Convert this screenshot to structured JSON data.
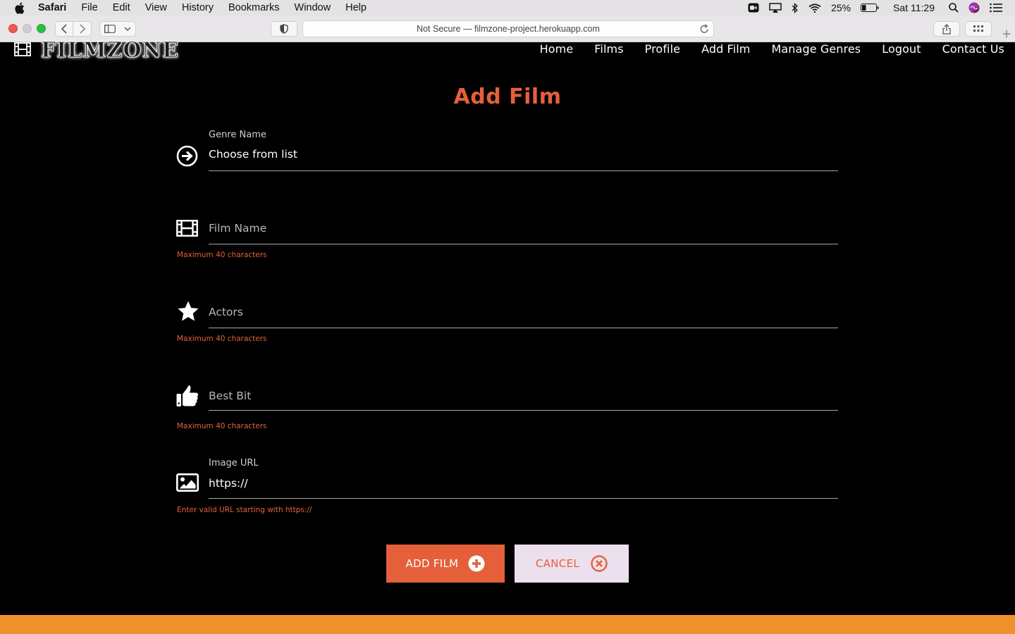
{
  "menubar": {
    "app": "Safari",
    "items": [
      "File",
      "Edit",
      "View",
      "History",
      "Bookmarks",
      "Window",
      "Help"
    ],
    "battery": "25%",
    "clock": "Sat 11:29"
  },
  "browser": {
    "url": "Not Secure — filmzone-project.herokuapp.com"
  },
  "site": {
    "brand": "FILMZONE",
    "nav": {
      "home": "Home",
      "films": "Films",
      "profile": "Profile",
      "add_film": "Add Film",
      "manage_genres": "Manage Genres",
      "logout": "Logout",
      "contact": "Contact Us"
    }
  },
  "form": {
    "title": "Add Film",
    "genre": {
      "label": "Genre Name",
      "value": "Choose from list"
    },
    "film_name": {
      "placeholder": "Film Name",
      "helper": "Maximum 40 characters"
    },
    "actors": {
      "placeholder": "Actors",
      "helper": "Maximum 40 characters"
    },
    "best_bit": {
      "placeholder": "Best Bit",
      "helper": "Maximum 40 characters"
    },
    "image_url": {
      "label": "Image URL",
      "value": "https://",
      "helper": "Enter valid URL starting with https://"
    },
    "add_button": "ADD FILM",
    "cancel_button": "CANCEL"
  },
  "colors": {
    "accent": "#e5603a",
    "footer": "#f0902c",
    "cancel_bg": "#ece0ee"
  }
}
